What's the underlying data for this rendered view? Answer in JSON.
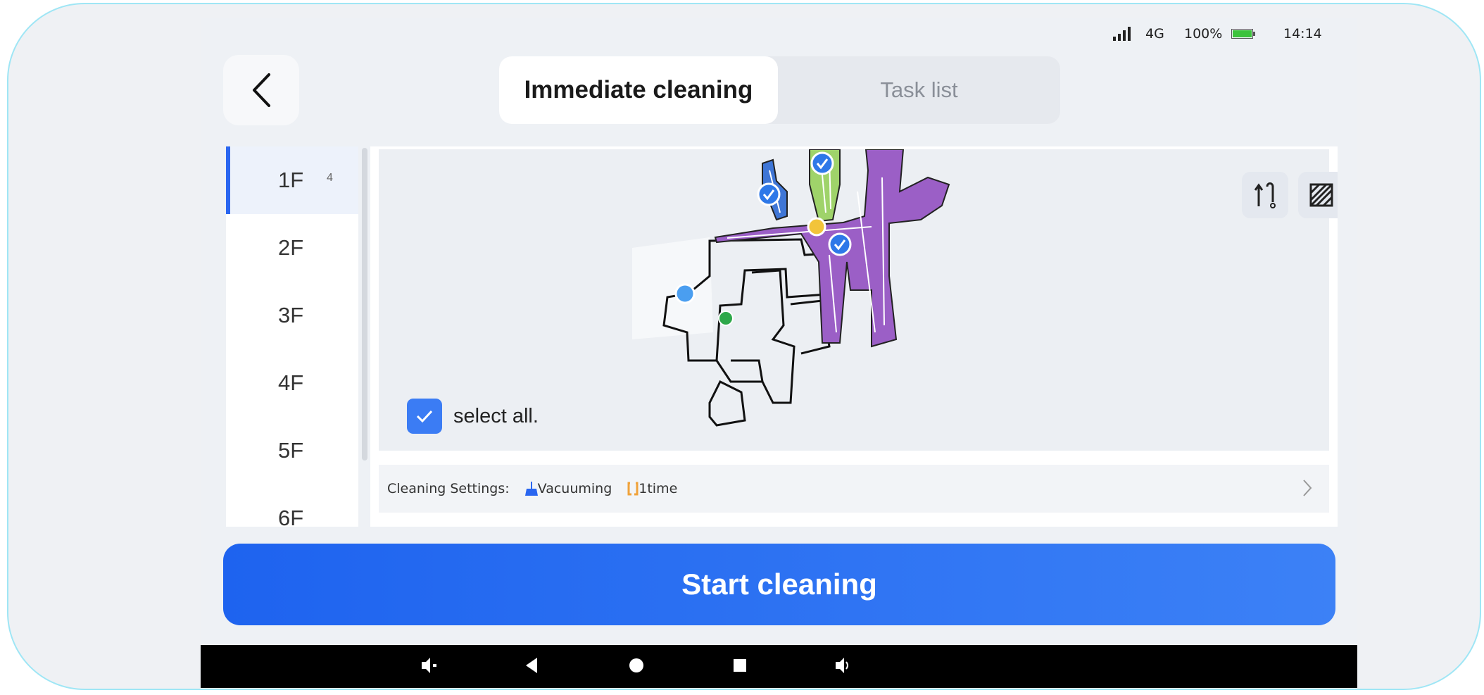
{
  "status_bar": {
    "signal_icon": "signal-bars-icon",
    "network": "4G",
    "battery_percent": "100%",
    "battery_icon": "battery-icon",
    "time": "14:14"
  },
  "header": {
    "back_icon": "chevron-left-icon",
    "tabs": [
      {
        "label": "Immediate cleaning",
        "active": true
      },
      {
        "label": "Task list",
        "active": false
      }
    ]
  },
  "floors": [
    {
      "label": "1F",
      "count": "4",
      "active": true
    },
    {
      "label": "2F"
    },
    {
      "label": "3F"
    },
    {
      "label": "4F"
    },
    {
      "label": "5F"
    },
    {
      "label": "6F"
    }
  ],
  "map": {
    "tools": [
      "route-icon",
      "hatch-pattern-icon"
    ],
    "select_all_label": "select all.",
    "select_all_checked": true,
    "colors": {
      "room_blue": "#3f76d6",
      "room_green": "#9fd36a",
      "room_purple": "#9b5fc6",
      "check_blue": "#2e78e8",
      "dock_yellow": "#f2c43a",
      "robot_green": "#2ea84a"
    }
  },
  "cleaning_settings": {
    "label": "Cleaning Settings:",
    "mode_icon": "broom-icon",
    "mode": "Vacuuming",
    "times_icon": "repeat-icon",
    "times": "1time"
  },
  "start_button": "Start cleaning",
  "nav_bar": [
    "volume-down-icon",
    "back-triangle-icon",
    "home-circle-icon",
    "recents-square-icon",
    "volume-up-icon"
  ]
}
